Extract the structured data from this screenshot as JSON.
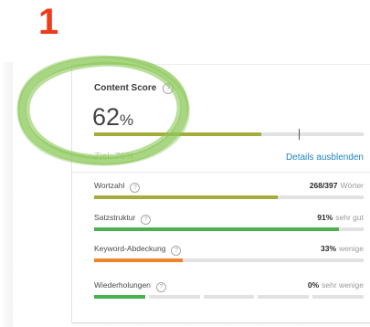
{
  "step_number": "1",
  "content_score": {
    "title": "Content Score",
    "value": "62",
    "unit": "%",
    "progress": 0.62,
    "target_marker": 0.76,
    "faded_label": "Ziel: 76%",
    "details_link": "Details ausblenden"
  },
  "metrics": [
    {
      "label": "Wortzahl",
      "value": "268/397",
      "tag": "Wörter",
      "progress": 0.68,
      "color": "#a2ad3a"
    },
    {
      "label": "Satzstruktur",
      "value": "91%",
      "tag": "sehr gut",
      "progress": 0.91,
      "color": "#4caf50"
    },
    {
      "label": "Keyword-Abdeckung",
      "value": "33%",
      "tag": "wenige",
      "progress": 0.33,
      "color": "#f0822a"
    },
    {
      "label": "Wiederholungen",
      "value": "0%",
      "tag": "sehr wenige",
      "segments": 5,
      "filled_segments": 1,
      "color": "#4caf50"
    }
  ],
  "colors": {
    "step_number": "#ee3b1c",
    "highlight_circle": "#8cc85a",
    "link": "#1f85c4",
    "score_bar": "#a2ad3a"
  },
  "icons": {
    "info": "info-circle-icon"
  }
}
